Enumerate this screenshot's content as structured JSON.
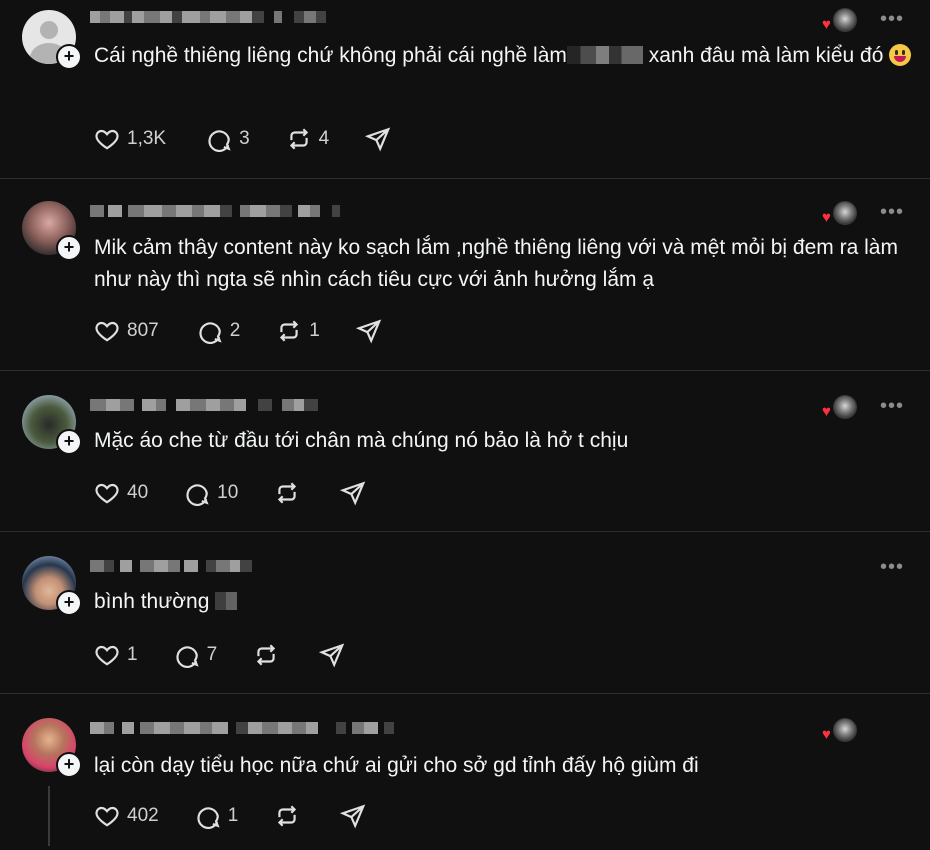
{
  "posts": [
    {
      "text": "Cái nghề thiêng liêng chứ không phải cái nghề làm",
      "text_after_blur": "xanh đâu mà làm kiểu đó",
      "emoji": "grinning-face",
      "likes": "1,3K",
      "replies": "3",
      "reposts": "4"
    },
    {
      "text": "Mik cảm thây content này ko sạch lắm ,nghề thiêng liêng với và mệt mỏi bị đem ra làm như này thì ngta sẽ nhìn cách tiêu cực với ảnh hưởng lắm ạ",
      "likes": "807",
      "replies": "2",
      "reposts": "1"
    },
    {
      "text": "Mặc áo che từ đầu tới chân mà chúng nó bảo là hở t chịu",
      "likes": "40",
      "replies": "10",
      "reposts": ""
    },
    {
      "text": "bình thường",
      "likes": "1",
      "replies": "7",
      "reposts": ""
    },
    {
      "text": "lại còn dạy tiểu học nữa chứ ai gửi cho sở gd tỉnh đấy hộ giùm đi",
      "likes": "402",
      "replies": "1",
      "reposts": ""
    }
  ],
  "colors": {
    "background": "#101010",
    "text": "#f3f5f7",
    "heart": "#ff3040",
    "divider": "#2d2d2d"
  },
  "icons": [
    "heart-icon",
    "comment-icon",
    "repost-icon",
    "share-icon",
    "more-icon",
    "follow-plus-icon"
  ]
}
